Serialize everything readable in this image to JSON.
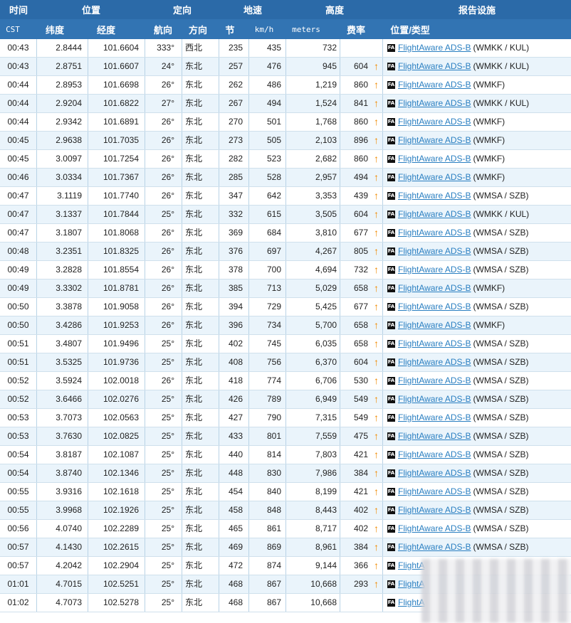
{
  "header": {
    "groups": [
      "时间",
      "位置",
      "定向",
      "地速",
      "高度",
      "报告设施"
    ],
    "columns": [
      "CST",
      "纬度",
      "经度",
      "航向",
      "方向",
      "节",
      "km/h",
      "meters",
      "费率",
      "位置/类型"
    ]
  },
  "colors": {
    "header_bg": "#2b6aa8",
    "row_alt": "#eaf4fb",
    "link": "#2a7fc1",
    "climb_arrow": "#f08a00"
  },
  "icons": {
    "fa_badge": "FA",
    "climb": "climb-arrow-icon"
  },
  "rows": [
    {
      "time": "00:43",
      "lat": "2.8444",
      "lon": "101.6604",
      "hdg": "333°",
      "dir": "西北",
      "kts": "235",
      "kmh": "435",
      "alt": "732",
      "rate": "",
      "link": "FlightAware ADS-B",
      "code": "(WMKK / KUL)"
    },
    {
      "time": "00:43",
      "lat": "2.8751",
      "lon": "101.6607",
      "hdg": "24°",
      "dir": "东北",
      "kts": "257",
      "kmh": "476",
      "alt": "945",
      "rate": "604",
      "link": "FlightAware ADS-B",
      "code": "(WMKK / KUL)"
    },
    {
      "time": "00:44",
      "lat": "2.8953",
      "lon": "101.6698",
      "hdg": "26°",
      "dir": "东北",
      "kts": "262",
      "kmh": "486",
      "alt": "1,219",
      "rate": "860",
      "link": "FlightAware ADS-B",
      "code": "(WMKF)"
    },
    {
      "time": "00:44",
      "lat": "2.9204",
      "lon": "101.6822",
      "hdg": "27°",
      "dir": "东北",
      "kts": "267",
      "kmh": "494",
      "alt": "1,524",
      "rate": "841",
      "link": "FlightAware ADS-B",
      "code": "(WMKK / KUL)"
    },
    {
      "time": "00:44",
      "lat": "2.9342",
      "lon": "101.6891",
      "hdg": "26°",
      "dir": "东北",
      "kts": "270",
      "kmh": "501",
      "alt": "1,768",
      "rate": "860",
      "link": "FlightAware ADS-B",
      "code": "(WMKF)"
    },
    {
      "time": "00:45",
      "lat": "2.9638",
      "lon": "101.7035",
      "hdg": "26°",
      "dir": "东北",
      "kts": "273",
      "kmh": "505",
      "alt": "2,103",
      "rate": "896",
      "link": "FlightAware ADS-B",
      "code": "(WMKF)"
    },
    {
      "time": "00:45",
      "lat": "3.0097",
      "lon": "101.7254",
      "hdg": "26°",
      "dir": "东北",
      "kts": "282",
      "kmh": "523",
      "alt": "2,682",
      "rate": "860",
      "link": "FlightAware ADS-B",
      "code": "(WMKF)"
    },
    {
      "time": "00:46",
      "lat": "3.0334",
      "lon": "101.7367",
      "hdg": "26°",
      "dir": "东北",
      "kts": "285",
      "kmh": "528",
      "alt": "2,957",
      "rate": "494",
      "link": "FlightAware ADS-B",
      "code": "(WMKF)"
    },
    {
      "time": "00:47",
      "lat": "3.1119",
      "lon": "101.7740",
      "hdg": "26°",
      "dir": "东北",
      "kts": "347",
      "kmh": "642",
      "alt": "3,353",
      "rate": "439",
      "link": "FlightAware ADS-B",
      "code": "(WMSA / SZB)"
    },
    {
      "time": "00:47",
      "lat": "3.1337",
      "lon": "101.7844",
      "hdg": "25°",
      "dir": "东北",
      "kts": "332",
      "kmh": "615",
      "alt": "3,505",
      "rate": "604",
      "link": "FlightAware ADS-B",
      "code": "(WMKK / KUL)"
    },
    {
      "time": "00:47",
      "lat": "3.1807",
      "lon": "101.8068",
      "hdg": "26°",
      "dir": "东北",
      "kts": "369",
      "kmh": "684",
      "alt": "3,810",
      "rate": "677",
      "link": "FlightAware ADS-B",
      "code": "(WMSA / SZB)"
    },
    {
      "time": "00:48",
      "lat": "3.2351",
      "lon": "101.8325",
      "hdg": "26°",
      "dir": "东北",
      "kts": "376",
      "kmh": "697",
      "alt": "4,267",
      "rate": "805",
      "link": "FlightAware ADS-B",
      "code": "(WMSA / SZB)"
    },
    {
      "time": "00:49",
      "lat": "3.2828",
      "lon": "101.8554",
      "hdg": "26°",
      "dir": "东北",
      "kts": "378",
      "kmh": "700",
      "alt": "4,694",
      "rate": "732",
      "link": "FlightAware ADS-B",
      "code": "(WMSA / SZB)"
    },
    {
      "time": "00:49",
      "lat": "3.3302",
      "lon": "101.8781",
      "hdg": "26°",
      "dir": "东北",
      "kts": "385",
      "kmh": "713",
      "alt": "5,029",
      "rate": "658",
      "link": "FlightAware ADS-B",
      "code": "(WMKF)"
    },
    {
      "time": "00:50",
      "lat": "3.3878",
      "lon": "101.9058",
      "hdg": "26°",
      "dir": "东北",
      "kts": "394",
      "kmh": "729",
      "alt": "5,425",
      "rate": "677",
      "link": "FlightAware ADS-B",
      "code": "(WMSA / SZB)"
    },
    {
      "time": "00:50",
      "lat": "3.4286",
      "lon": "101.9253",
      "hdg": "26°",
      "dir": "东北",
      "kts": "396",
      "kmh": "734",
      "alt": "5,700",
      "rate": "658",
      "link": "FlightAware ADS-B",
      "code": "(WMKF)"
    },
    {
      "time": "00:51",
      "lat": "3.4807",
      "lon": "101.9496",
      "hdg": "25°",
      "dir": "东北",
      "kts": "402",
      "kmh": "745",
      "alt": "6,035",
      "rate": "658",
      "link": "FlightAware ADS-B",
      "code": "(WMSA / SZB)"
    },
    {
      "time": "00:51",
      "lat": "3.5325",
      "lon": "101.9736",
      "hdg": "25°",
      "dir": "东北",
      "kts": "408",
      "kmh": "756",
      "alt": "6,370",
      "rate": "604",
      "link": "FlightAware ADS-B",
      "code": "(WMSA / SZB)"
    },
    {
      "time": "00:52",
      "lat": "3.5924",
      "lon": "102.0018",
      "hdg": "26°",
      "dir": "东北",
      "kts": "418",
      "kmh": "774",
      "alt": "6,706",
      "rate": "530",
      "link": "FlightAware ADS-B",
      "code": "(WMSA / SZB)"
    },
    {
      "time": "00:52",
      "lat": "3.6466",
      "lon": "102.0276",
      "hdg": "25°",
      "dir": "东北",
      "kts": "426",
      "kmh": "789",
      "alt": "6,949",
      "rate": "549",
      "link": "FlightAware ADS-B",
      "code": "(WMSA / SZB)"
    },
    {
      "time": "00:53",
      "lat": "3.7073",
      "lon": "102.0563",
      "hdg": "25°",
      "dir": "东北",
      "kts": "427",
      "kmh": "790",
      "alt": "7,315",
      "rate": "549",
      "link": "FlightAware ADS-B",
      "code": "(WMSA / SZB)"
    },
    {
      "time": "00:53",
      "lat": "3.7630",
      "lon": "102.0825",
      "hdg": "25°",
      "dir": "东北",
      "kts": "433",
      "kmh": "801",
      "alt": "7,559",
      "rate": "475",
      "link": "FlightAware ADS-B",
      "code": "(WMSA / SZB)"
    },
    {
      "time": "00:54",
      "lat": "3.8187",
      "lon": "102.1087",
      "hdg": "25°",
      "dir": "东北",
      "kts": "440",
      "kmh": "814",
      "alt": "7,803",
      "rate": "421",
      "link": "FlightAware ADS-B",
      "code": "(WMSA / SZB)"
    },
    {
      "time": "00:54",
      "lat": "3.8740",
      "lon": "102.1346",
      "hdg": "25°",
      "dir": "东北",
      "kts": "448",
      "kmh": "830",
      "alt": "7,986",
      "rate": "384",
      "link": "FlightAware ADS-B",
      "code": "(WMSA / SZB)"
    },
    {
      "time": "00:55",
      "lat": "3.9316",
      "lon": "102.1618",
      "hdg": "25°",
      "dir": "东北",
      "kts": "454",
      "kmh": "840",
      "alt": "8,199",
      "rate": "421",
      "link": "FlightAware ADS-B",
      "code": "(WMSA / SZB)"
    },
    {
      "time": "00:55",
      "lat": "3.9968",
      "lon": "102.1926",
      "hdg": "25°",
      "dir": "东北",
      "kts": "458",
      "kmh": "848",
      "alt": "8,443",
      "rate": "402",
      "link": "FlightAware ADS-B",
      "code": "(WMSA / SZB)"
    },
    {
      "time": "00:56",
      "lat": "4.0740",
      "lon": "102.2289",
      "hdg": "25°",
      "dir": "东北",
      "kts": "465",
      "kmh": "861",
      "alt": "8,717",
      "rate": "402",
      "link": "FlightAware ADS-B",
      "code": "(WMSA / SZB)"
    },
    {
      "time": "00:57",
      "lat": "4.1430",
      "lon": "102.2615",
      "hdg": "25°",
      "dir": "东北",
      "kts": "469",
      "kmh": "869",
      "alt": "8,961",
      "rate": "384",
      "link": "FlightAware ADS-B",
      "code": "(WMSA / SZB)"
    },
    {
      "time": "00:57",
      "lat": "4.2042",
      "lon": "102.2904",
      "hdg": "25°",
      "dir": "东北",
      "kts": "472",
      "kmh": "874",
      "alt": "9,144",
      "rate": "366",
      "link": "FlightA",
      "code": ""
    },
    {
      "time": "01:01",
      "lat": "4.7015",
      "lon": "102.5251",
      "hdg": "25°",
      "dir": "东北",
      "kts": "468",
      "kmh": "867",
      "alt": "10,668",
      "rate": "293",
      "link": "FlightA",
      "code": ""
    },
    {
      "time": "01:02",
      "lat": "4.7073",
      "lon": "102.5278",
      "hdg": "25°",
      "dir": "东北",
      "kts": "468",
      "kmh": "867",
      "alt": "10,668",
      "rate": "",
      "link": "FlightA",
      "code": ""
    }
  ]
}
